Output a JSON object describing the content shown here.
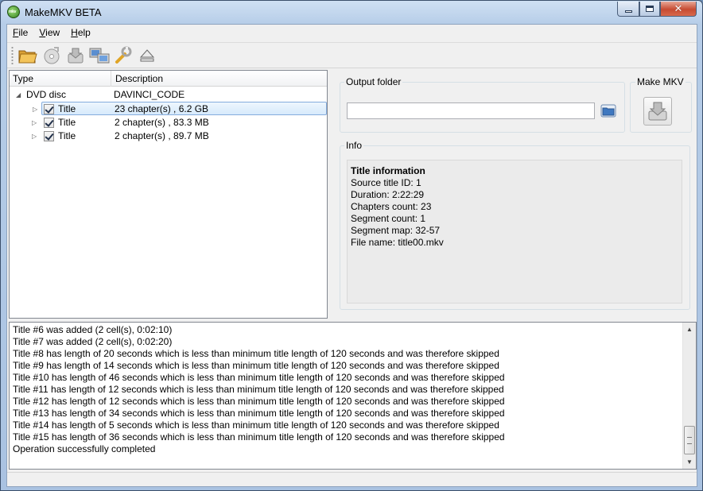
{
  "window": {
    "title": "MakeMKV BETA",
    "app_icon_text": "mkv"
  },
  "menu": [
    {
      "label": "File",
      "accel": "F",
      "rest": "ile"
    },
    {
      "label": "View",
      "accel": "V",
      "rest": "iew"
    },
    {
      "label": "Help",
      "accel": "H",
      "rest": "elp"
    }
  ],
  "toolbar": [
    "open-files-icon",
    "open-disc-icon",
    "backup-icon",
    "stream-icon",
    "preferences-icon",
    "eject-icon"
  ],
  "tree": {
    "headers": {
      "type": "Type",
      "description": "Description"
    },
    "disc": {
      "type": "DVD disc",
      "description": "DAVINCI_CODE"
    },
    "titles": [
      {
        "type": "Title",
        "description": "23 chapter(s) , 6.2 GB",
        "checked": true,
        "selected": true
      },
      {
        "type": "Title",
        "description": "2 chapter(s) , 83.3 MB",
        "checked": true,
        "selected": false
      },
      {
        "type": "Title",
        "description": "2 chapter(s) , 89.7 MB",
        "checked": true,
        "selected": false
      }
    ]
  },
  "output": {
    "group_title": "Output folder",
    "value": ""
  },
  "make": {
    "group_title": "Make MKV"
  },
  "info": {
    "group_title": "Info",
    "heading": "Title information",
    "lines": [
      "Source title ID: 1",
      "Duration: 2:22:29",
      "Chapters count: 23",
      "Segment count: 1",
      "Segment map: 32-57",
      "File name: title00.mkv"
    ]
  },
  "log": [
    "Title #6 was added (2 cell(s), 0:02:10)",
    "Title #7 was added (2 cell(s), 0:02:20)",
    "Title #8 has length of 20 seconds which is less than minimum title length of 120 seconds and was therefore skipped",
    "Title #9 has length of 14 seconds which is less than minimum title length of 120 seconds and was therefore skipped",
    "Title #10 has length of 46 seconds which is less than minimum title length of 120 seconds and was therefore skipped",
    "Title #11 has length of 12 seconds which is less than minimum title length of 120 seconds and was therefore skipped",
    "Title #12 has length of 12 seconds which is less than minimum title length of 120 seconds and was therefore skipped",
    "Title #13 has length of 34 seconds which is less than minimum title length of 120 seconds and was therefore skipped",
    "Title #14 has length of 5 seconds which is less than minimum title length of 120 seconds and was therefore skipped",
    "Title #15 has length of 36 seconds which is less than minimum title length of 120 seconds and was therefore skipped",
    "Operation successfully completed"
  ],
  "colors": {
    "selection_border": "#84acdd",
    "titlebar": "#b6cde8",
    "close_red": "#c74b32"
  }
}
